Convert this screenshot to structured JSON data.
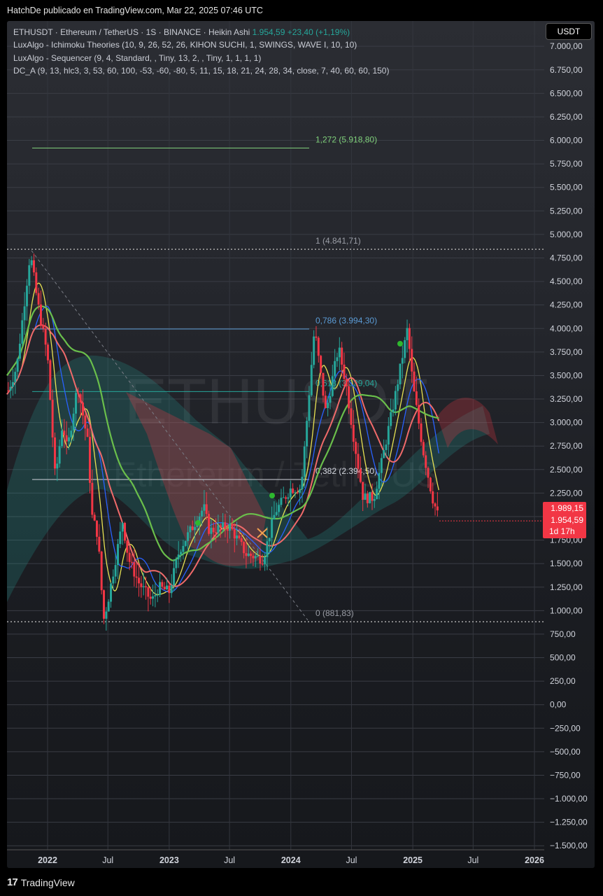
{
  "header": {
    "publisher_text": "HatchDe publicado en TradingView.com, Mar 22, 2025 07:46 UTC"
  },
  "legend": {
    "symbol_line": "ETHUSDT · Ethereum / TetherUS · 1S · BINANCE · Heikin Ashi",
    "last_price": "1.954,59",
    "change": "+23,40 (+1,19%)",
    "indicators": [
      "LuxAlgo - Ichimoku Theories (10, 9, 26, 52, 26, KIHON SUCHI, 1, SWINGS, WAVE I, 10, 10)",
      "LuxAlgo - Sequencer (9, 4, Standard, , Tiny, 13, 2, , Tiny, 1, 1, 1, 1)",
      "DC_A (9, 13, hlc3, 3, 53, 60, 100, -53, -60, -80, 5, 11, 15, 18, 21, 24, 28, 34, close, 7, 40, 60, 60, 150)"
    ]
  },
  "currency_button": "USDT",
  "price_tag": {
    "line1": "1.989,15",
    "line2": "1.954,59",
    "line3": "1d 17h"
  },
  "footer": {
    "brand": "TradingView",
    "logo_glyph": "17"
  },
  "watermark": {
    "symbol": "ETHUSDT",
    "name": "Ethereum / TetherUS"
  },
  "colors": {
    "bull": "#26a69a",
    "bear": "#f23645",
    "fib_green": "#7fd07a",
    "fib_blue": "#5b9bd5"
  },
  "chart_data": {
    "type": "candlestick",
    "y_ticks": [
      7000,
      6750,
      6500,
      6250,
      6000,
      5750,
      5500,
      5250,
      5000,
      4750,
      4500,
      4250,
      4000,
      3750,
      3500,
      3250,
      3000,
      2750,
      2500,
      2250,
      2000,
      1750,
      1500,
      1250,
      1000,
      750,
      500,
      250,
      0,
      -250,
      -500,
      -750,
      -1000,
      -1250,
      -1500
    ],
    "y_tick_labels": [
      "7.000,00",
      "6.750,00",
      "6.500,00",
      "6.250,00",
      "6.000,00",
      "5.750,00",
      "5.500,00",
      "5.250,00",
      "5.000,00",
      "4.750,00",
      "4.500,00",
      "4.250,00",
      "4.000,00",
      "3.750,00",
      "3.500,00",
      "3.250,00",
      "3.000,00",
      "2.750,00",
      "2.500,00",
      "2.250,00",
      "2.000,00",
      "1.750,00",
      "1.500,00",
      "1.250,00",
      "1.000,00",
      "750,00",
      "500,00",
      "250,00",
      "0,00",
      "−250,00",
      "−500,00",
      "−750,00",
      "−1.000,00",
      "−1.250,00",
      "−1.500,00"
    ],
    "x_ticks": [
      {
        "label": "2022",
        "date": "2022-01-01",
        "bold": true
      },
      {
        "label": "Jul",
        "date": "2022-07-01",
        "bold": false
      },
      {
        "label": "2023",
        "date": "2023-01-01",
        "bold": true
      },
      {
        "label": "Jul",
        "date": "2023-07-01",
        "bold": false
      },
      {
        "label": "2024",
        "date": "2024-01-01",
        "bold": true
      },
      {
        "label": "Jul",
        "date": "2024-07-01",
        "bold": false
      },
      {
        "label": "2025",
        "date": "2025-01-01",
        "bold": true
      },
      {
        "label": "Jul",
        "date": "2025-07-01",
        "bold": false
      },
      {
        "label": "2026",
        "date": "2026-01-01",
        "bold": true
      }
    ],
    "fib_levels": [
      {
        "label": "1,272 (5.918,80)",
        "value": 5918.8,
        "color": "#7fd07a",
        "dotted": false
      },
      {
        "label": "1 (4.841,71)",
        "value": 4841.71,
        "color": "#9a9da5",
        "dotted": true
      },
      {
        "label": "0,786 (3.994,30)",
        "value": 3994.3,
        "color": "#5b9bd5",
        "dotted": false
      },
      {
        "label": "0,618 (3.329,04)",
        "value": 3329.04,
        "color": "#26a69a",
        "dotted": false
      },
      {
        "label": "0,382 (2.394,50)",
        "value": 2394.5,
        "color": "#d1d4dc",
        "dotted": false
      },
      {
        "label": "0 (881,83)",
        "value": 881.83,
        "color": "#9a9da5",
        "dotted": true
      }
    ],
    "price_path": [
      [
        "2021-09-01",
        3300
      ],
      [
        "2021-10-01",
        3600
      ],
      [
        "2021-11-10",
        4800
      ],
      [
        "2021-12-01",
        4300
      ],
      [
        "2022-01-01",
        3700
      ],
      [
        "2022-01-24",
        2400
      ],
      [
        "2022-02-15",
        3000
      ],
      [
        "2022-03-01",
        2700
      ],
      [
        "2022-04-01",
        3400
      ],
      [
        "2022-05-01",
        2800
      ],
      [
        "2022-05-15",
        2000
      ],
      [
        "2022-06-01",
        1800
      ],
      [
        "2022-06-18",
        900
      ],
      [
        "2022-07-01",
        1100
      ],
      [
        "2022-08-14",
        1950
      ],
      [
        "2022-09-01",
        1550
      ],
      [
        "2022-10-01",
        1300
      ],
      [
        "2022-11-10",
        1100
      ],
      [
        "2022-12-01",
        1250
      ],
      [
        "2023-01-01",
        1200
      ],
      [
        "2023-02-01",
        1650
      ],
      [
        "2023-04-15",
        2100
      ],
      [
        "2023-05-01",
        1850
      ],
      [
        "2023-07-01",
        1900
      ],
      [
        "2023-08-20",
        1600
      ],
      [
        "2023-10-10",
        1550
      ],
      [
        "2023-11-15",
        2050
      ],
      [
        "2024-01-01",
        2300
      ],
      [
        "2024-02-01",
        2300
      ],
      [
        "2024-03-12",
        4000
      ],
      [
        "2024-04-15",
        3100
      ],
      [
        "2024-05-23",
        3800
      ],
      [
        "2024-06-15",
        3400
      ],
      [
        "2024-07-05",
        2900
      ],
      [
        "2024-08-05",
        2200
      ],
      [
        "2024-09-06",
        2200
      ],
      [
        "2024-10-01",
        2600
      ],
      [
        "2024-11-10",
        3300
      ],
      [
        "2024-12-16",
        4000
      ],
      [
        "2025-01-01",
        3400
      ],
      [
        "2025-02-01",
        2700
      ],
      [
        "2025-03-01",
        2200
      ],
      [
        "2025-03-22",
        1954.59
      ]
    ],
    "last_price": 1954.59
  }
}
